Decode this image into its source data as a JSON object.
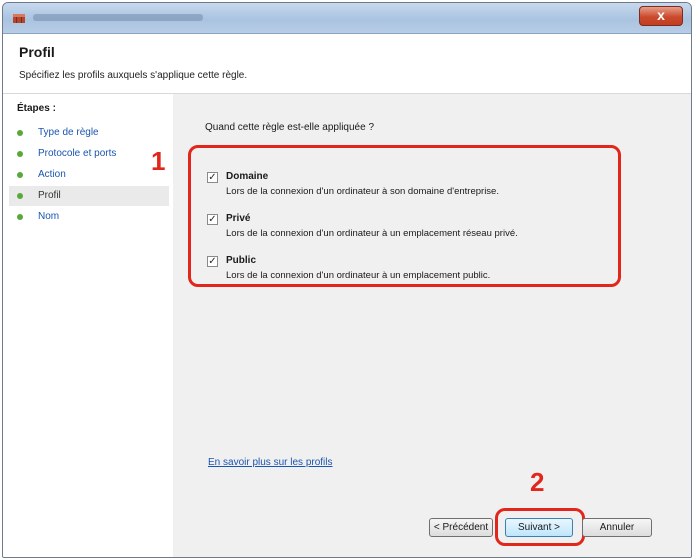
{
  "window": {
    "close_glyph": "x"
  },
  "header": {
    "title": "Profil",
    "subtitle": "Spécifiez les profils auxquels s'applique cette règle."
  },
  "sidebar": {
    "heading": "Étapes :",
    "items": [
      {
        "label": "Type de règle",
        "current": false
      },
      {
        "label": "Protocole et ports",
        "current": false
      },
      {
        "label": "Action",
        "current": false
      },
      {
        "label": "Profil",
        "current": true
      },
      {
        "label": "Nom",
        "current": false
      }
    ]
  },
  "main": {
    "question": "Quand cette règle est-elle appliquée ?",
    "options": [
      {
        "label": "Domaine",
        "checked": true,
        "description": "Lors de la connexion d'un ordinateur à son domaine d'entreprise."
      },
      {
        "label": "Privé",
        "checked": true,
        "description": "Lors de la connexion d'un ordinateur à un emplacement réseau privé."
      },
      {
        "label": "Public",
        "checked": true,
        "description": "Lors de la connexion d'un ordinateur à un emplacement public."
      }
    ],
    "learn_more_link": "En savoir plus sur les profils"
  },
  "buttons": {
    "previous": "< Précédent",
    "next": "Suivant >",
    "cancel": "Annuler"
  },
  "annotations": {
    "marker_1": "1",
    "marker_2": "2"
  },
  "colors": {
    "annotation_red": "#e2261c",
    "step_dot_green": "#58a83a",
    "link_blue": "#1a55b0"
  }
}
